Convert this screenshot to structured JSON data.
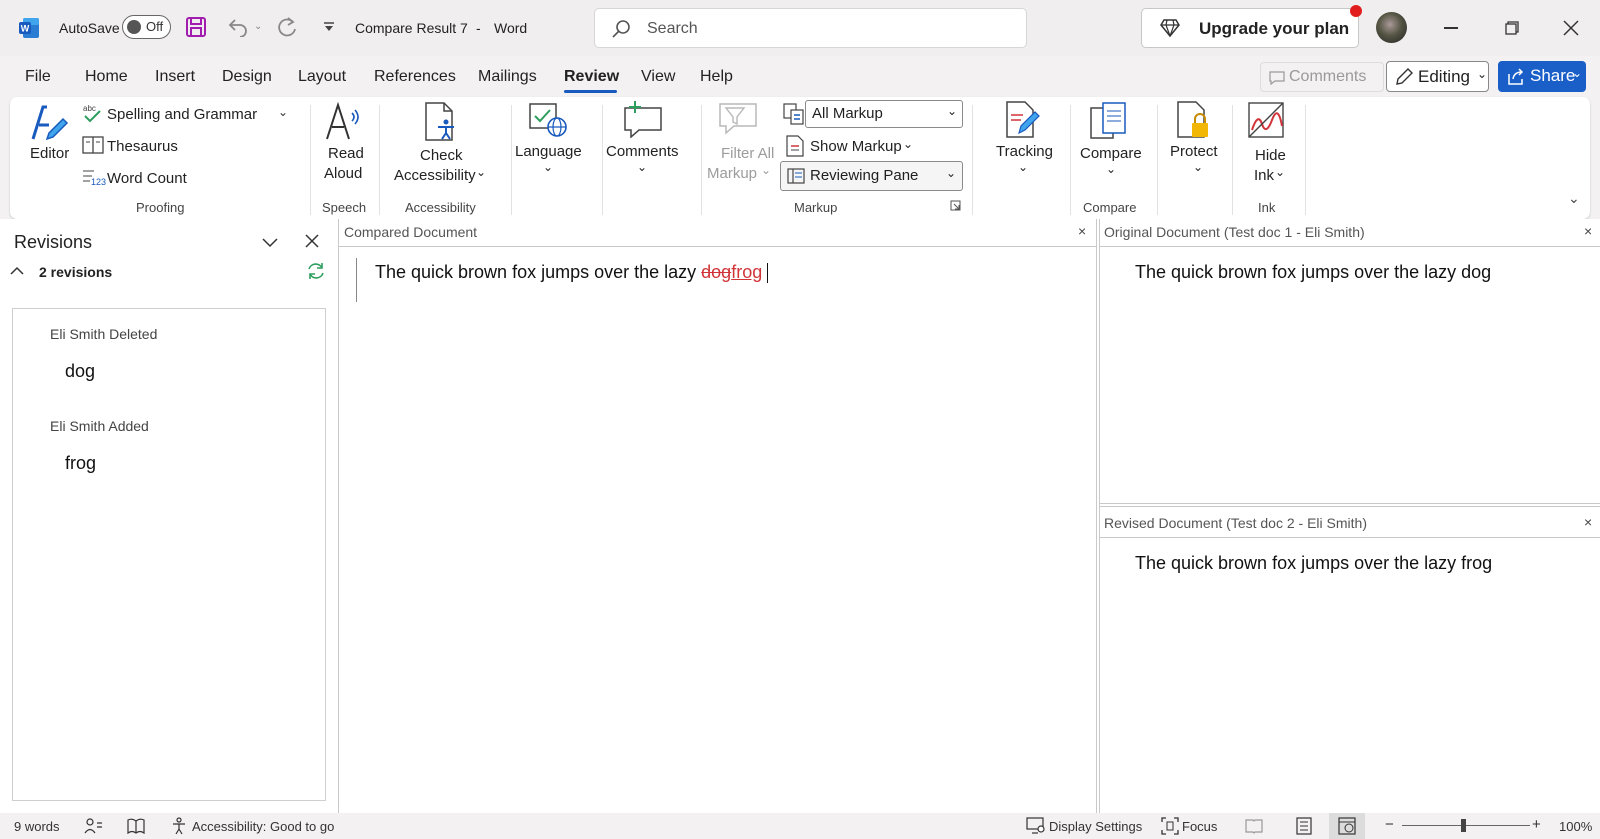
{
  "titlebar": {
    "autosave_label": "AutoSave",
    "autosave_state": "Off",
    "doc_title": "Compare Result 7",
    "separator": "-",
    "app_name": "Word",
    "search_placeholder": "Search",
    "upgrade_label": "Upgrade your plan"
  },
  "menu": {
    "tabs": [
      "File",
      "Home",
      "Insert",
      "Design",
      "Layout",
      "References",
      "Mailings",
      "Review",
      "View",
      "Help"
    ],
    "active_tab": "Review",
    "comments_label": "Comments",
    "editing_label": "Editing",
    "share_label": "Share"
  },
  "ribbon": {
    "editor": "Editor",
    "spelling": "Spelling and Grammar",
    "thesaurus": "Thesaurus",
    "word_count": "Word Count",
    "proofing": "Proofing",
    "read": "Read",
    "aloud": "Aloud",
    "speech": "Speech",
    "check": "Check",
    "accessibility_btn": "Accessibility",
    "accessibility_grp": "Accessibility",
    "language": "Language",
    "comments": "Comments",
    "filter_all": "Filter All",
    "markup_btn": "Markup",
    "all_markup": "All Markup",
    "show_markup": "Show Markup",
    "reviewing_pane": "Reviewing Pane",
    "markup_grp": "Markup",
    "tracking": "Tracking",
    "compare_btn": "Compare",
    "compare_grp": "Compare",
    "protect": "Protect",
    "hide": "Hide",
    "ink_btn": "Ink",
    "ink_grp": "Ink"
  },
  "revisions": {
    "title": "Revisions",
    "count_label": "2 revisions",
    "items": [
      {
        "author_action": "Eli Smith Deleted",
        "text": "dog"
      },
      {
        "author_action": "Eli Smith Added",
        "text": "frog"
      }
    ]
  },
  "compared": {
    "header": "Compared Document",
    "text_prefix": "The quick brown fox jumps over the lazy ",
    "deleted": "dog",
    "inserted": "frog"
  },
  "original": {
    "header": "Original Document (Test doc 1 - Eli Smith)",
    "text": "The quick brown fox jumps over the lazy dog"
  },
  "revised": {
    "header": "Revised Document (Test doc 2 - Eli Smith)",
    "text": "The quick brown fox jumps over the lazy frog"
  },
  "statusbar": {
    "word_count": "9 words",
    "accessibility": "Accessibility: Good to go",
    "display_settings": "Display Settings",
    "focus": "Focus",
    "zoom": "100%"
  },
  "colors": {
    "accent_blue": "#185abd",
    "share_blue": "#1a5fc8",
    "revision_red": "#d13438",
    "refresh_green": "#2e9e5e"
  }
}
